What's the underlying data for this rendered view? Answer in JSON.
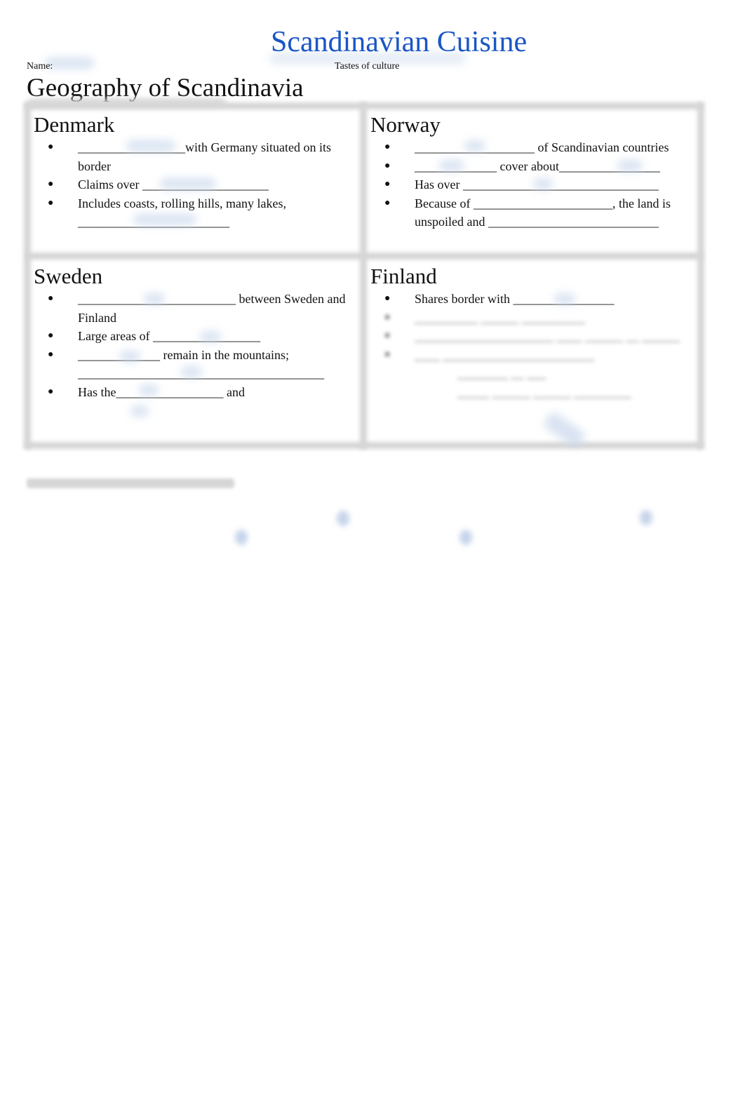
{
  "header": {
    "title": "Scandinavian Cuisine",
    "name_label": "Name:",
    "subtitle": "Tastes of culture"
  },
  "section": {
    "title": "Geography of Scandinavia"
  },
  "cells": {
    "denmark": {
      "heading": "Denmark",
      "items": [
        "_________________with Germany situated on its border",
        "Claims over ____________________",
        "Includes coasts, rolling hills, many lakes, ________________________"
      ]
    },
    "norway": {
      "heading": "Norway",
      "items": [
        "___________________ of Scandinavian countries",
        "_____________ cover about________________",
        "Has over _______________________________",
        "Because of ______________________, the land is unspoiled and ___________________________"
      ]
    },
    "sweden": {
      "heading": "Sweden",
      "items": [
        "_________________________ between Sweden and Finland",
        "Large areas of _________________",
        "_____________ remain in the mountains; _______________________________________",
        "Has the_________________ and"
      ]
    },
    "finland": {
      "heading": "Finland",
      "items": [
        "Shares border with ________________"
      ],
      "blurred_items": [
        "__________ ______ __________",
        "______________________ ____ ______ __ ______",
        "____ ________________________",
        "________ __ ___",
        "_____ ______ ______ _________"
      ]
    }
  },
  "bullet_char": "●"
}
